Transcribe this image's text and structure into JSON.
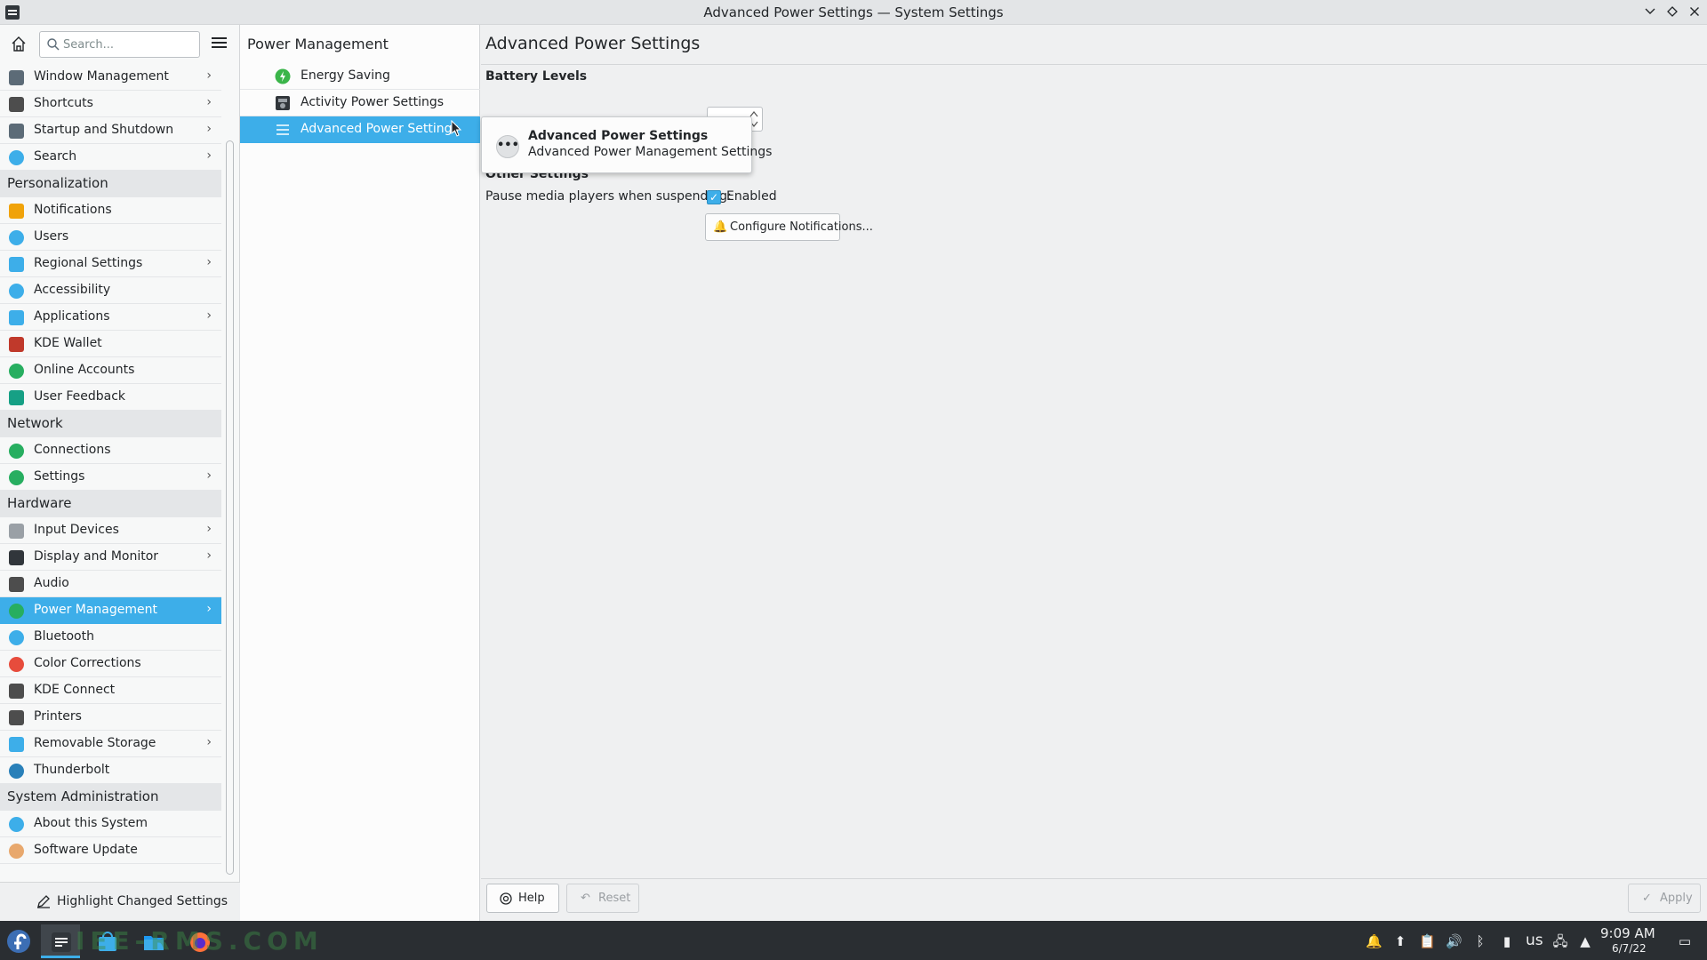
{
  "window": {
    "title": "Advanced Power Settings — System Settings",
    "controls": [
      "chevron-down",
      "diamond",
      "close"
    ]
  },
  "sidebar": {
    "search_placeholder": "Search...",
    "items": [
      {
        "label": "Window Management",
        "icon": "window-management-icon",
        "has_children": true,
        "color": "#5c6b77"
      },
      {
        "label": "Shortcuts",
        "icon": "keyboard-icon",
        "has_children": true,
        "color": "#4d4d4d"
      },
      {
        "label": "Startup and Shutdown",
        "icon": "startup-icon",
        "has_children": true,
        "color": "#5c6b77"
      },
      {
        "label": "Search",
        "icon": "search-icon",
        "has_children": true,
        "color": "#3daee9"
      },
      {
        "category": "Personalization"
      },
      {
        "label": "Notifications",
        "icon": "bell-icon",
        "has_children": false,
        "color": "#f0a30a"
      },
      {
        "label": "Users",
        "icon": "users-icon",
        "has_children": false,
        "color": "#3daee9"
      },
      {
        "label": "Regional Settings",
        "icon": "regional-icon",
        "has_children": true,
        "color": "#3daee9"
      },
      {
        "label": "Accessibility",
        "icon": "accessibility-icon",
        "has_children": false,
        "color": "#3daee9"
      },
      {
        "label": "Applications",
        "icon": "applications-icon",
        "has_children": true,
        "color": "#3daee9"
      },
      {
        "label": "KDE Wallet",
        "icon": "wallet-icon",
        "has_children": false,
        "color": "#c0392b"
      },
      {
        "label": "Online Accounts",
        "icon": "globe-icon",
        "has_children": false,
        "color": "#27ae60"
      },
      {
        "label": "User Feedback",
        "icon": "feedback-icon",
        "has_children": false,
        "color": "#16a085"
      },
      {
        "category": "Network"
      },
      {
        "label": "Connections",
        "icon": "globe-icon",
        "has_children": false,
        "color": "#27ae60"
      },
      {
        "label": "Settings",
        "icon": "network-settings-icon",
        "has_children": true,
        "color": "#27ae60"
      },
      {
        "category": "Hardware"
      },
      {
        "label": "Input Devices",
        "icon": "mouse-icon",
        "has_children": true,
        "color": "#9aa0a6"
      },
      {
        "label": "Display and Monitor",
        "icon": "monitor-icon",
        "has_children": true,
        "color": "#31363b"
      },
      {
        "label": "Audio",
        "icon": "speaker-icon",
        "has_children": false,
        "color": "#4d4d4d"
      },
      {
        "label": "Power Management",
        "icon": "power-icon",
        "has_children": true,
        "color": "#27ae60",
        "active": true
      },
      {
        "label": "Bluetooth",
        "icon": "bluetooth-icon",
        "has_children": false,
        "color": "#3daee9"
      },
      {
        "label": "Color Corrections",
        "icon": "color-icon",
        "has_children": false,
        "color": "#e74c3c"
      },
      {
        "label": "KDE Connect",
        "icon": "phone-icon",
        "has_children": false,
        "color": "#4d4d4d"
      },
      {
        "label": "Printers",
        "icon": "printer-icon",
        "has_children": false,
        "color": "#4d4d4d"
      },
      {
        "label": "Removable Storage",
        "icon": "usb-icon",
        "has_children": true,
        "color": "#3daee9"
      },
      {
        "label": "Thunderbolt",
        "icon": "thunderbolt-icon",
        "has_children": false,
        "color": "#2980b9"
      },
      {
        "category": "System Administration"
      },
      {
        "label": "About this System",
        "icon": "info-icon",
        "has_children": false,
        "color": "#3daee9"
      },
      {
        "label": "Software Update",
        "icon": "update-icon",
        "has_children": false,
        "color": "#e8a86d"
      }
    ],
    "footer_label": "Highlight Changed Settings"
  },
  "middle": {
    "title": "Power Management",
    "items": [
      {
        "label": "Energy Saving",
        "icon": "energy-saving-icon"
      },
      {
        "label": "Activity Power Settings",
        "icon": "activity-icon"
      },
      {
        "label": "Advanced Power Settings",
        "icon": "hamburger-icon",
        "active": true
      }
    ]
  },
  "content": {
    "title": "Advanced Power Settings",
    "battery_section": "Battery Levels",
    "other_section": "Other Settings",
    "pause_label": "Pause media players when suspending:",
    "pause_checkbox_label": "Enabled",
    "pause_checked": true,
    "configure_button": "Configure Notifications...",
    "tooltip": {
      "title": "Advanced Power Settings",
      "subtitle": "Advanced Power Management Settings"
    },
    "help_button": "Help",
    "reset_button": "Reset",
    "apply_button": "Apply"
  },
  "taskbar": {
    "watermark": "IEE-RMS.COM",
    "keyboard_layout": "us",
    "time": "9:09 AM",
    "date": "6/7/22"
  }
}
